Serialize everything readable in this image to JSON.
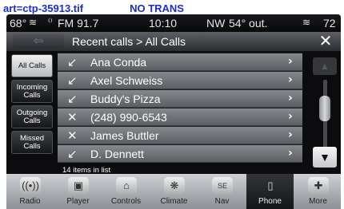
{
  "art_label": {
    "id": "art=ctp-35913.tif",
    "note": "NO TRANS"
  },
  "status": {
    "temp_left": "68°",
    "left_seat_icon": "heated-seat-icon",
    "radio": "FM 91.7",
    "time": "10:10",
    "compass": "NW",
    "outside_temp": "54° out.",
    "temp_right": "72"
  },
  "header": {
    "back_glyph": "⇦",
    "breadcrumb": "Recent calls > All Calls",
    "close_glyph": "✕"
  },
  "sidebar": {
    "items": [
      {
        "label": "All Calls",
        "active": true
      },
      {
        "label": "Incoming Calls",
        "active": false
      },
      {
        "label": "Outgoing Calls",
        "active": false
      },
      {
        "label": "Missed Calls",
        "active": false
      }
    ]
  },
  "calls": [
    {
      "name": "Ana Conda",
      "icon": "incoming-call-icon",
      "glyph": "↙",
      "chevron": "›"
    },
    {
      "name": "Axel Schweiss",
      "icon": "incoming-call-icon",
      "glyph": "↙",
      "chevron": "›"
    },
    {
      "name": "Buddy's Pizza",
      "icon": "incoming-call-icon",
      "glyph": "↙",
      "chevron": "›"
    },
    {
      "name": "(248) 990-6543",
      "icon": "missed-call-icon",
      "glyph": "✕",
      "chevron": "›"
    },
    {
      "name": "James Buttler",
      "icon": "missed-call-icon",
      "glyph": "✕",
      "chevron": "›"
    },
    {
      "name": "D. Dennett",
      "icon": "incoming-call-icon",
      "glyph": "↙",
      "chevron": "›"
    }
  ],
  "list_count": "14 items in list",
  "scroll": {
    "up": "▲",
    "down": "▼"
  },
  "tabs": [
    {
      "label": "Radio",
      "icon": "radio-icon",
      "glyph": "((•))",
      "active": false
    },
    {
      "label": "Player",
      "icon": "player-icon",
      "glyph": "▣",
      "active": false
    },
    {
      "label": "Controls",
      "icon": "controls-icon",
      "glyph": "⌂",
      "active": false
    },
    {
      "label": "Climate",
      "icon": "climate-icon",
      "glyph": "❋",
      "active": false
    },
    {
      "label": "Nav",
      "icon": "nav-icon",
      "glyph": "SE",
      "active": false
    },
    {
      "label": "Phone",
      "icon": "phone-icon",
      "glyph": "▯",
      "active": true
    },
    {
      "label": "More",
      "icon": "more-icon",
      "glyph": "✚",
      "active": false
    }
  ]
}
